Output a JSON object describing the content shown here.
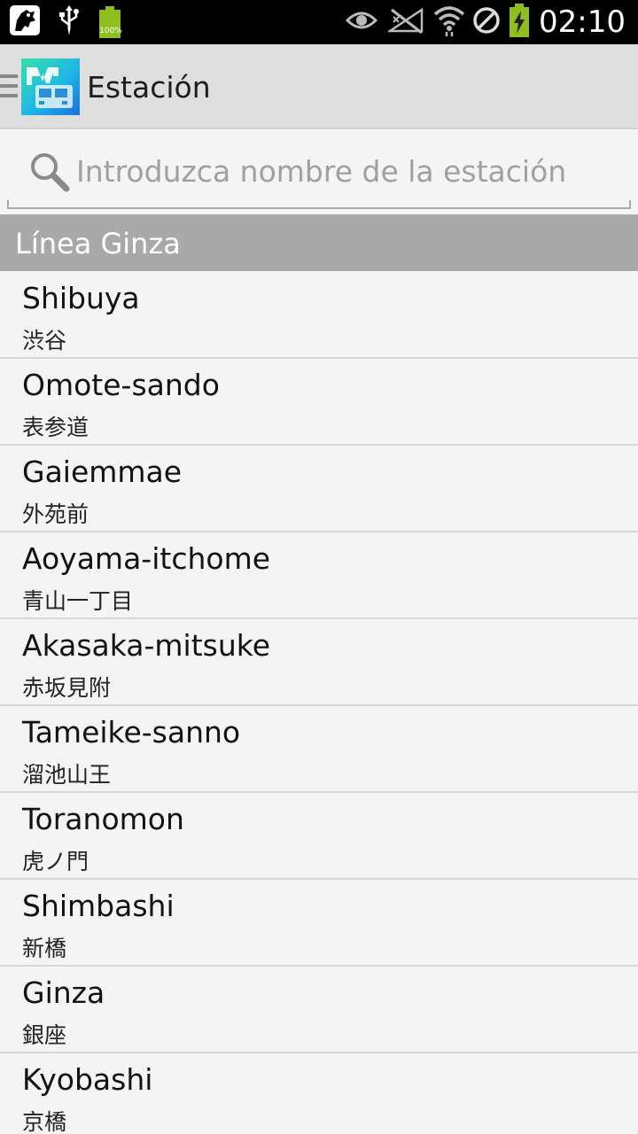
{
  "status_bar": {
    "battery_label": "100%",
    "time": "02:10",
    "icons_left": [
      "app-notification-icon",
      "usb-icon",
      "battery-full-icon"
    ],
    "icons_right": [
      "eye-icon",
      "no-signal-icon",
      "wifi-icon",
      "blocked-icon",
      "battery-charging-icon"
    ]
  },
  "action_bar": {
    "title": "Estación",
    "app_icon": "metro-app-icon",
    "drawer_icon": "drawer-menu-icon"
  },
  "search": {
    "placeholder": "Introduzca nombre de la estación",
    "value": ""
  },
  "section": {
    "label": "Línea Ginza"
  },
  "stations": [
    {
      "name": "Shibuya",
      "jp": "渋谷"
    },
    {
      "name": "Omote-sando",
      "jp": "表参道"
    },
    {
      "name": "Gaiemmae",
      "jp": "外苑前"
    },
    {
      "name": "Aoyama-itchome",
      "jp": "青山一丁目"
    },
    {
      "name": "Akasaka-mitsuke",
      "jp": "赤坂見附"
    },
    {
      "name": "Tameike-sanno",
      "jp": "溜池山王"
    },
    {
      "name": "Toranomon",
      "jp": "虎ノ門"
    },
    {
      "name": "Shimbashi",
      "jp": "新橋"
    },
    {
      "name": "Ginza",
      "jp": "銀座"
    },
    {
      "name": "Kyobashi",
      "jp": "京橋"
    }
  ],
  "colors": {
    "section_bg": "#a9a9a9",
    "action_bar_bg": "#dedede",
    "list_bg": "#f4f4f4",
    "battery_green": "#8fbf1f"
  }
}
